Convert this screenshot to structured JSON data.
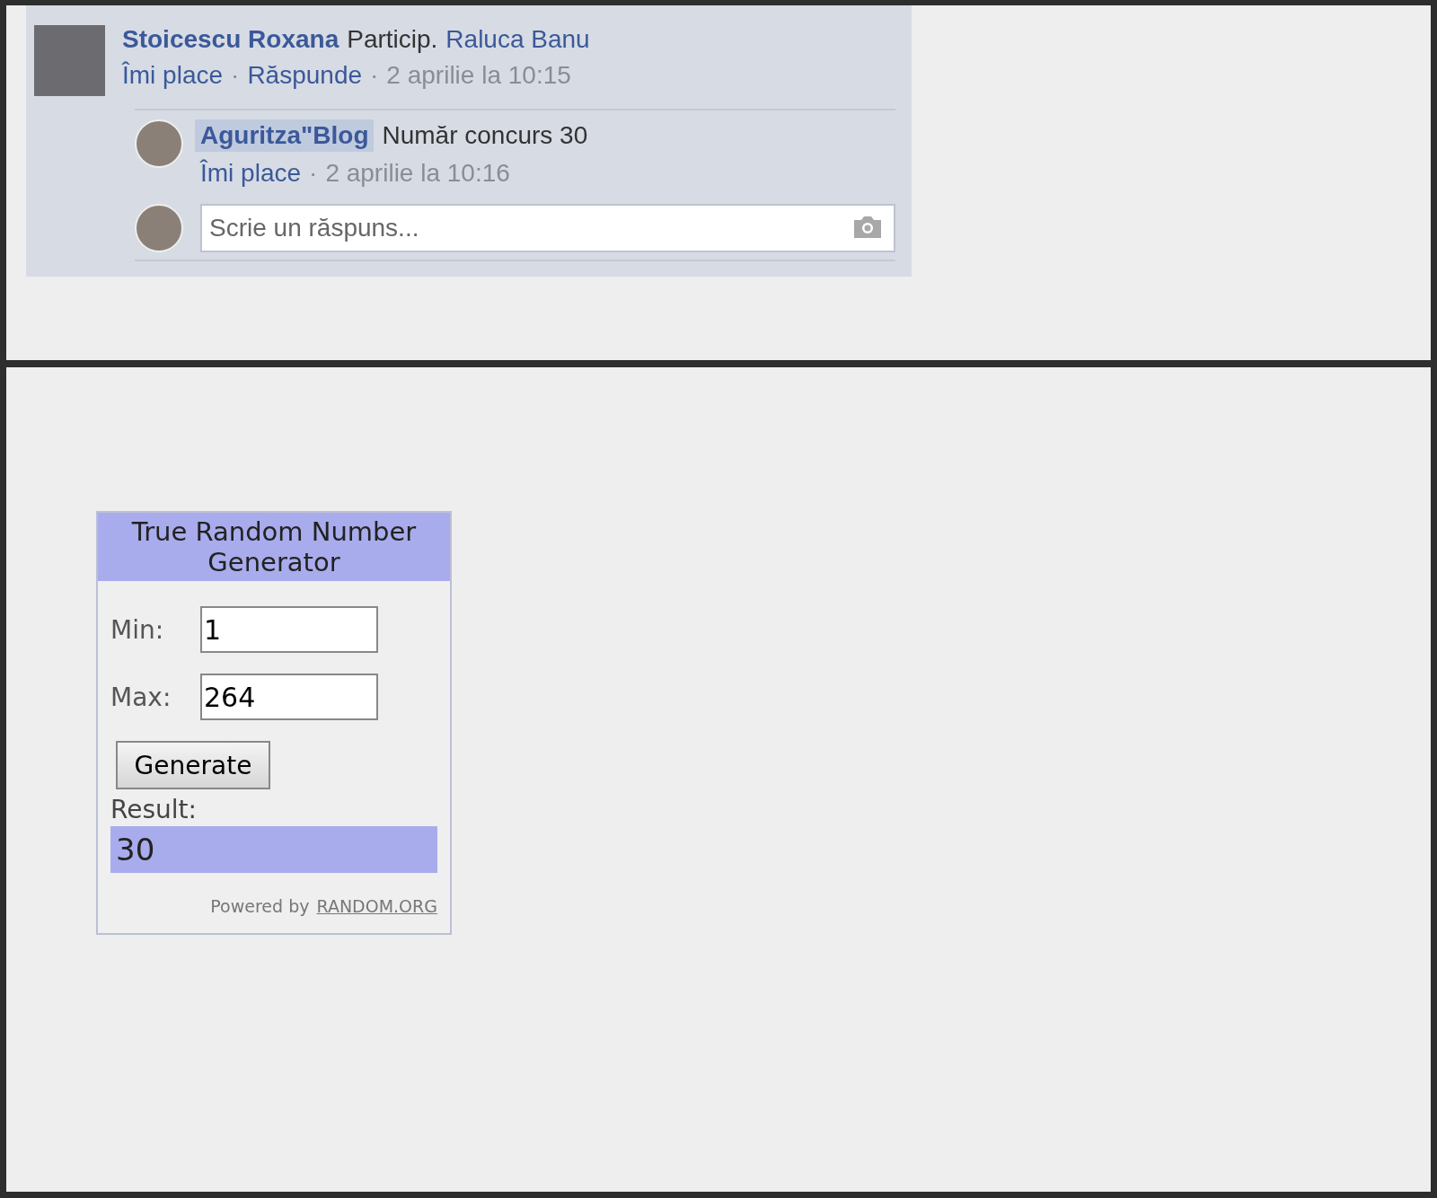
{
  "comment": {
    "author": "Stoicescu Roxana",
    "text": "Particip.",
    "mention": "Raluca Banu",
    "actions": [
      "Îmi place",
      "Răspunde"
    ],
    "separator": "·",
    "time": "2 aprilie la 10:15"
  },
  "reply": {
    "author": "Aguritza\"Blog",
    "text": "Număr concurs 30",
    "actions": [
      "Îmi place"
    ],
    "separator": "·",
    "time": "2 aprilie la 10:16"
  },
  "reply_field": {
    "placeholder": "Scrie un răspuns..."
  },
  "widget": {
    "title": "True Random Number Generator",
    "fields": [
      {
        "label": "Min:",
        "value": "1"
      },
      {
        "label": "Max:",
        "value": "264"
      }
    ],
    "button": "Generate",
    "result_label": "Result:",
    "result": "30",
    "powered_by": "Powered by",
    "link": "RANDOM.ORG"
  }
}
